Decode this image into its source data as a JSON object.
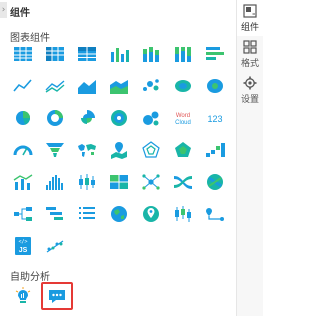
{
  "header": {
    "collapse_glyph": "›",
    "title": "组件"
  },
  "sections": {
    "charts_title": "图表组件",
    "analysis_title": "自助分析"
  },
  "colors": {
    "primary": "#1a9be0",
    "teal": "#19b5a8",
    "green": "#3cc46f",
    "selected_outline": "#e53935"
  },
  "chart_icons": [
    "table-icon",
    "cross-table-icon",
    "detail-table-icon",
    "bar-chart-icon",
    "stacked-bar-icon",
    "percent-bar-icon",
    "horizontal-bar-icon",
    "line-chart-icon",
    "multi-line-icon",
    "area-chart-icon",
    "stacked-area-icon",
    "scatter-icon",
    "bubble-icon",
    "map-bubble-icon",
    "pie-chart-icon",
    "donut-chart-icon",
    "rose-chart-icon",
    "sunburst-icon",
    "cluster-bubble-icon",
    "word-cloud-icon",
    "kpi-number-icon",
    "gauge-icon",
    "funnel-icon",
    "world-map-icon",
    "map-pin-icon",
    "radar-icon",
    "pentagon-radar-icon",
    "step-bar-icon",
    "combo-bar-line-icon",
    "histogram-icon",
    "boxplot-icon",
    "heat-table-icon",
    "network-icon",
    "sankey-icon",
    "chord-icon",
    "tree-icon",
    "gantt-icon",
    "list-icon",
    "globe-icon",
    "location-icon",
    "candlestick-icon",
    "route-icon",
    "js-code-icon",
    "trend-scatter-icon"
  ],
  "word_cloud": {
    "line1": "Word",
    "line2": "Cloud"
  },
  "kpi_number": {
    "text": "123"
  },
  "js_code": {
    "top": "</>",
    "text": "JS"
  },
  "analysis_icons": [
    "insight-lightbulb-icon",
    "chat-assistant-icon"
  ],
  "side_tabs": [
    {
      "name": "components",
      "label": "组件",
      "icon": "component-icon",
      "active": true
    },
    {
      "name": "format",
      "label": "格式",
      "icon": "grid-format-icon",
      "active": false
    },
    {
      "name": "settings",
      "label": "设置",
      "icon": "gear-icon",
      "active": false
    }
  ]
}
